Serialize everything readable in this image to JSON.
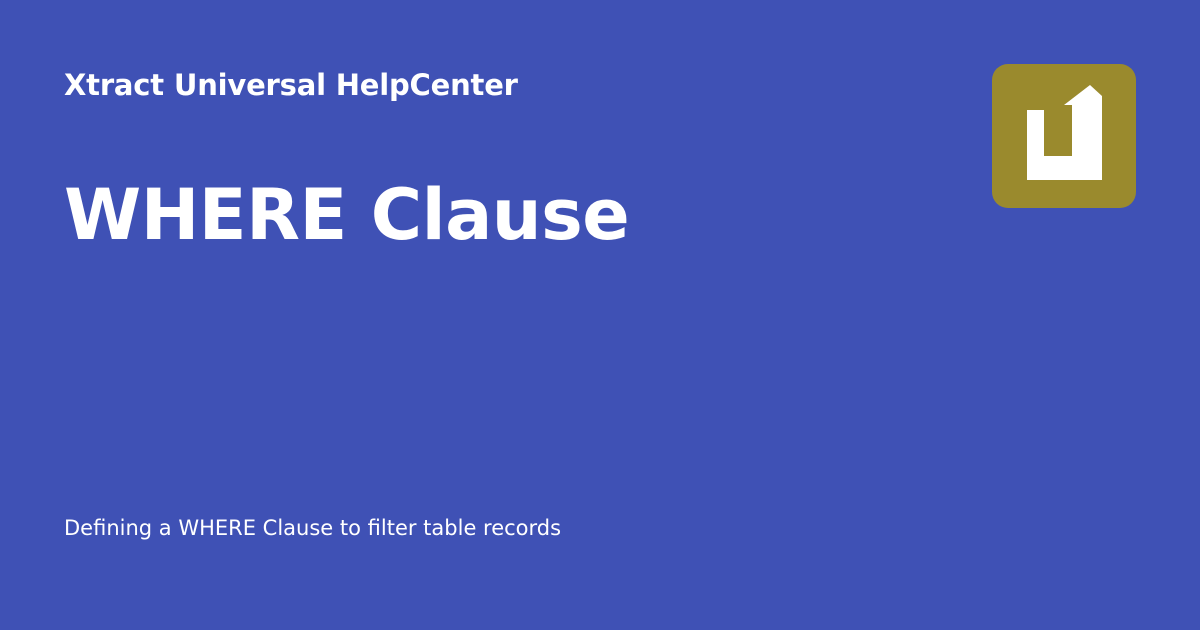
{
  "site": {
    "name": "Xtract Universal HelpCenter"
  },
  "page": {
    "title": "WHERE Clause",
    "description": "Defining a WHERE Clause to filter table records"
  },
  "logo": {
    "icon": "xtract-universal-logo-icon",
    "letter": "U",
    "background_color": "#9a8a2d",
    "glyph_color": "#ffffff"
  },
  "colors": {
    "background": "#3f51b5",
    "text": "#ffffff"
  }
}
